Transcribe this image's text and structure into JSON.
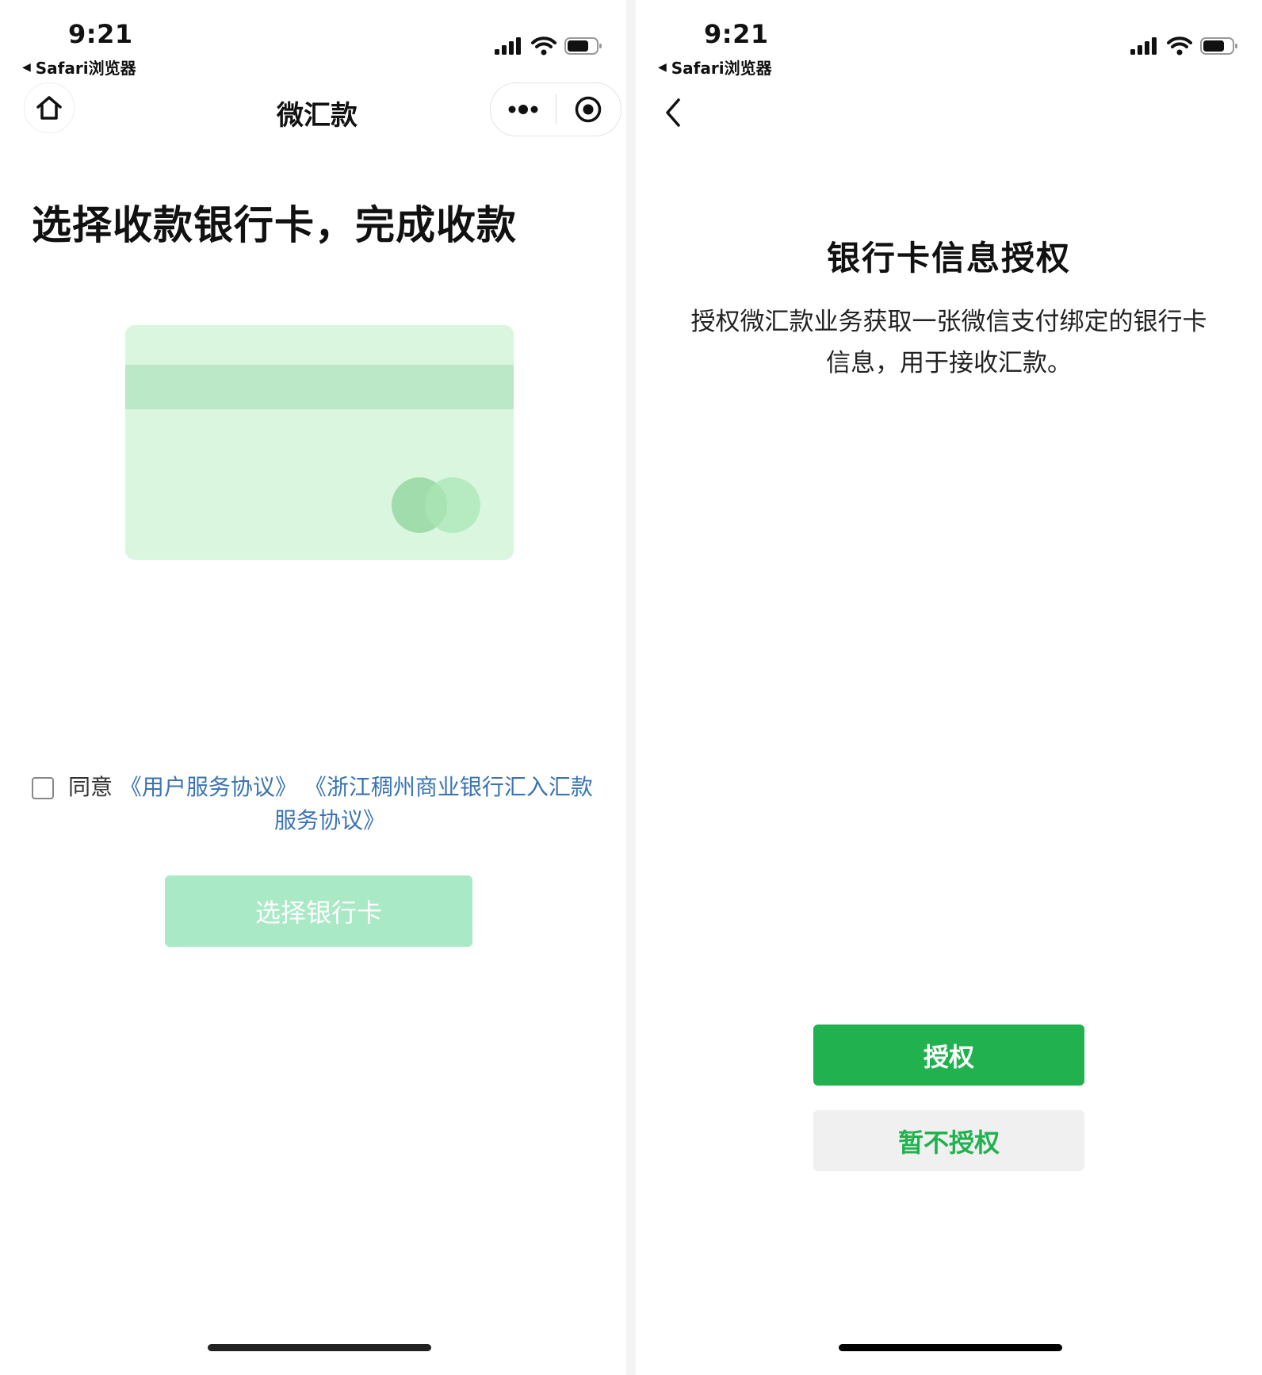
{
  "colors": {
    "wechat_green": "#21b24f",
    "disabled_green": "#a9e9c6",
    "link_blue": "#3a74b3",
    "card_light_green": "#daf6df"
  },
  "left_screen": {
    "status_bar": {
      "time": "9:21",
      "back_label": "Safari浏览器",
      "icons": [
        "signal-icon",
        "wifi-icon",
        "battery-icon"
      ]
    },
    "nav": {
      "title": "微汇款",
      "icons": [
        "home-icon",
        "more-icon",
        "close-capsule-icon"
      ]
    },
    "headline": "选择收款银行卡，完成收款",
    "agreement": {
      "prefix": "同意",
      "link1": "《用户服务协议》",
      "link2_line1": "《浙江稠州商业银行汇入汇款",
      "link2_line2": "服务协议》"
    },
    "select_button_label": "选择银行卡"
  },
  "right_screen": {
    "status_bar": {
      "time": "9:21",
      "back_label": "Safari浏览器",
      "icons": [
        "signal-icon",
        "wifi-icon",
        "battery-icon"
      ]
    },
    "title": "银行卡信息授权",
    "description": "授权微汇款业务获取一张微信支付绑定的银行卡信息，用于接收汇款。",
    "authorize_label": "授权",
    "decline_label": "暂不授权"
  }
}
